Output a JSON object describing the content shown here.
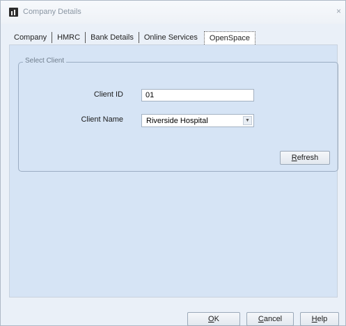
{
  "window": {
    "title": "Company Details",
    "close_glyph": "×"
  },
  "tabs": [
    {
      "label": "Company",
      "active": false
    },
    {
      "label": "HMRC",
      "active": false
    },
    {
      "label": "Bank Details",
      "active": false
    },
    {
      "label": "Online Services",
      "active": false
    },
    {
      "label": "OpenSpace",
      "active": true
    }
  ],
  "select_client": {
    "group_label": "Select Client",
    "client_id_label": "Client ID",
    "client_id_value": "01",
    "client_name_label": "Client Name",
    "client_name_value": "Riverside Hospital",
    "refresh_prefix": "",
    "refresh_hotkey": "R",
    "refresh_rest": "efresh"
  },
  "buttons": {
    "ok_hotkey": "O",
    "ok_rest": "K",
    "cancel_hotkey": "C",
    "cancel_rest": "ancel",
    "help_prefix": "",
    "help_hotkey": "H",
    "help_rest": "elp"
  },
  "icons": {
    "app": "app-chart-icon",
    "close": "close-icon",
    "dropdown": "chevron-down-icon"
  }
}
